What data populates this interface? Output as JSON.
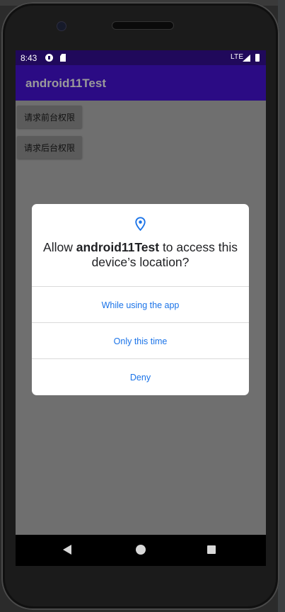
{
  "status_bar": {
    "time": "8:43",
    "network": "LTE",
    "icons": [
      "cast-icon",
      "sd-card-icon",
      "signal-icon",
      "battery-icon"
    ]
  },
  "app_bar": {
    "title": "android11Test"
  },
  "buttons": {
    "foreground": "请求前台权限",
    "background": "请求后台权限"
  },
  "dialog": {
    "icon": "location-pin-icon",
    "title_prefix": "Allow ",
    "title_app": "android11Test",
    "title_suffix": " to access this device’s location?",
    "options": [
      "While using the app",
      "Only this time",
      "Deny"
    ]
  },
  "nav_bar": {
    "icons": [
      "back-icon",
      "home-icon",
      "recents-icon"
    ]
  },
  "colors": {
    "status_bar": "#20095b",
    "app_bar": "#2b0b84",
    "scrim": "#6f6f6f",
    "dialog_accent": "#1a73e8"
  }
}
